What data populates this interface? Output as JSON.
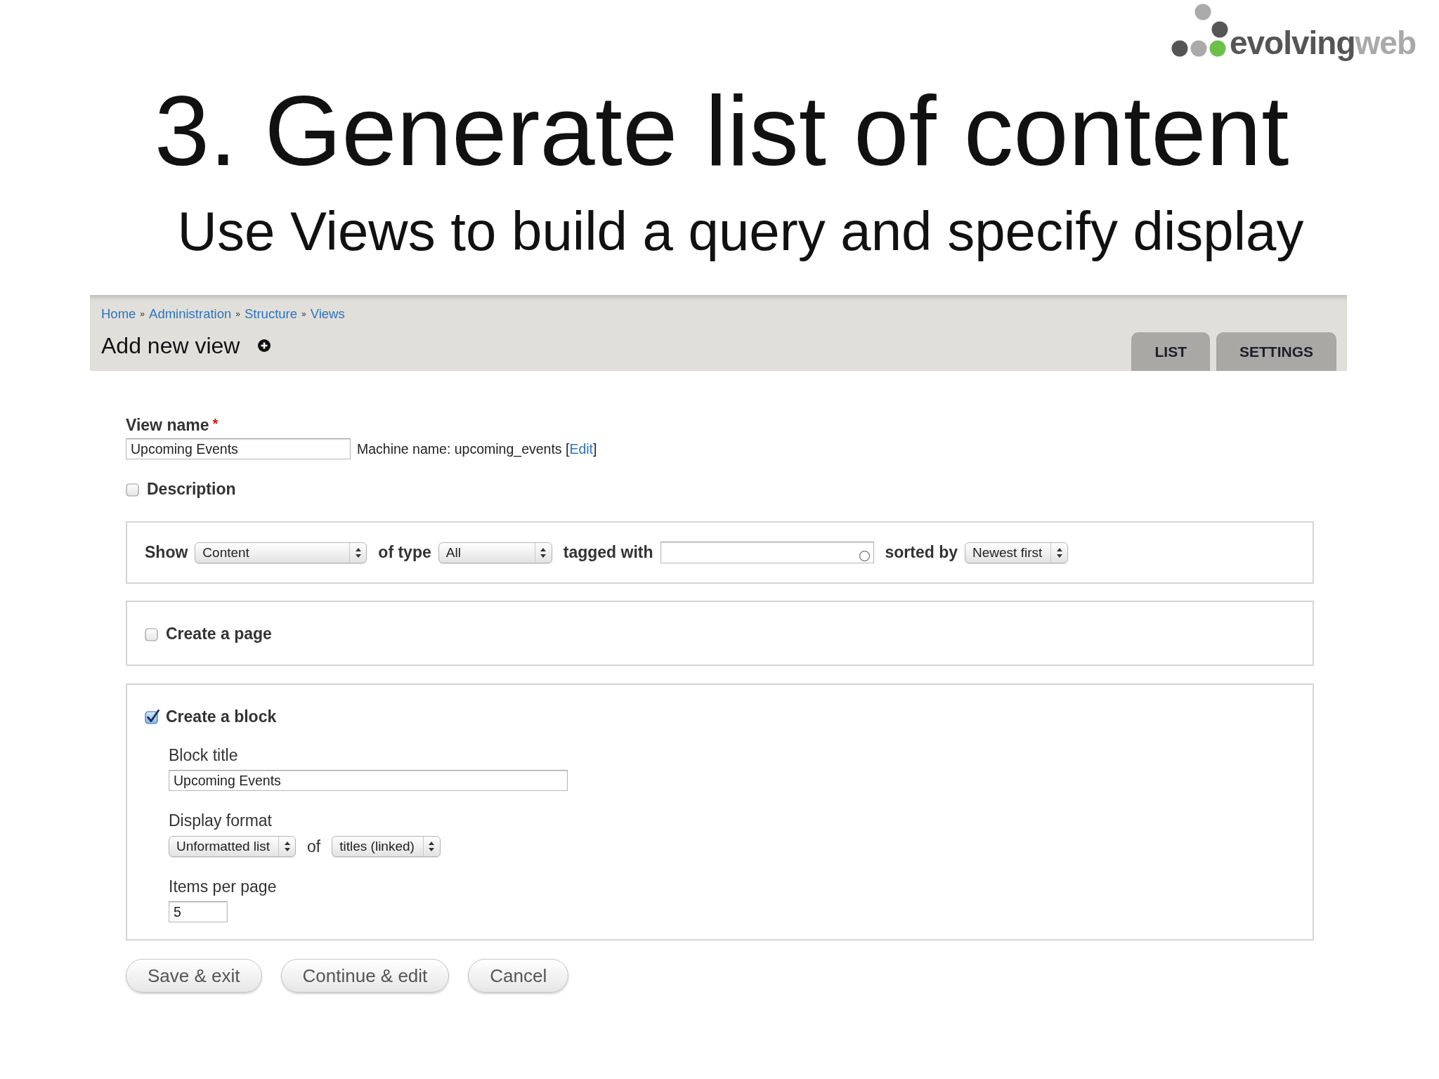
{
  "logo": {
    "dark_part": "evolving",
    "light_part": "web"
  },
  "title": "3. Generate list of content",
  "subtitle": "Use Views to build a query and specify display",
  "breadcrumb": [
    {
      "kind": "link",
      "text": "Home"
    },
    {
      "kind": "separator",
      "text": "»"
    },
    {
      "kind": "link",
      "text": "Administration"
    },
    {
      "kind": "separator",
      "text": "»"
    },
    {
      "kind": "link",
      "text": "Structure"
    },
    {
      "kind": "separator",
      "text": "»"
    },
    {
      "kind": "link",
      "text": "Views"
    }
  ],
  "page_title": "Add new view",
  "tabs": [
    {
      "label": "LIST",
      "selected": false
    },
    {
      "label": "SETTINGS",
      "selected": false
    }
  ],
  "view_name": {
    "label": "View name",
    "required_mark": "*",
    "value": "Upcoming Events",
    "machine_name": {
      "prefix": "Machine name: upcoming_events [",
      "link": "Edit",
      "suffix": "]"
    }
  },
  "description": {
    "label": "Description",
    "checked": false
  },
  "query": [
    {
      "kind": "label",
      "text": "Show"
    },
    {
      "kind": "select",
      "value": "Content"
    },
    {
      "kind": "label",
      "text": "of type"
    },
    {
      "kind": "select",
      "value": "All"
    },
    {
      "kind": "label",
      "text": "tagged with"
    },
    {
      "kind": "autocomplete"
    },
    {
      "kind": "label",
      "text": "sorted by"
    },
    {
      "kind": "select",
      "value": "Newest first"
    }
  ],
  "create_page": {
    "label": "Create a page",
    "checked": false
  },
  "create_block": {
    "label": "Create a block",
    "checked": true,
    "block_title": {
      "label": "Block title",
      "value": "Upcoming Events"
    },
    "display_format": {
      "label": "Display format",
      "format": "Unformatted list",
      "joiner": "of",
      "row_style": "titles (linked)"
    },
    "items_per_page": {
      "label": "Items per page",
      "value": "5"
    }
  },
  "buttons": [
    "Save & exit",
    "Continue & edit",
    "Cancel"
  ]
}
